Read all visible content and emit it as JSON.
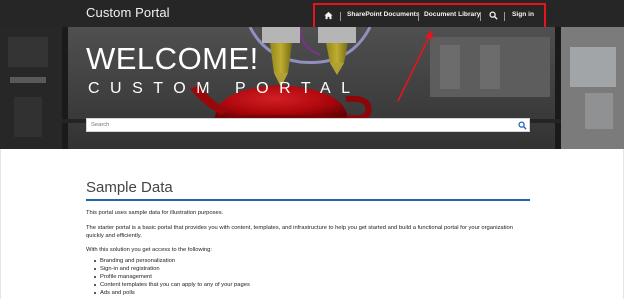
{
  "navbar": {
    "brand": "Custom Portal",
    "items": [
      {
        "label": "SharePoint Documents"
      },
      {
        "label": "Document Library"
      },
      {
        "label": "Sign in"
      }
    ],
    "home_icon": "home-icon",
    "search_icon": "search-icon",
    "annotation_color": "#e8141c"
  },
  "hero": {
    "title": "WELCOME!",
    "subtitle": "CUSTOM PORTAL",
    "search_placeholder": "Search",
    "search_button_icon": "search-icon"
  },
  "content": {
    "title": "Sample Data",
    "accent_color": "#2266b2",
    "paragraphs": [
      "This portal uses sample data for illustration purposes.",
      "The starter portal is a basic portal that provides you with content, templates, and infrastructure to help you get started and build a functional portal for your organization quickly and efficiently.",
      "With this solution you get access to the following:"
    ],
    "features": [
      "Branding and personalization",
      "Sign-in and registration",
      "Profile management",
      "Content templates that you can apply to any of your pages",
      "Ads and polls"
    ]
  }
}
